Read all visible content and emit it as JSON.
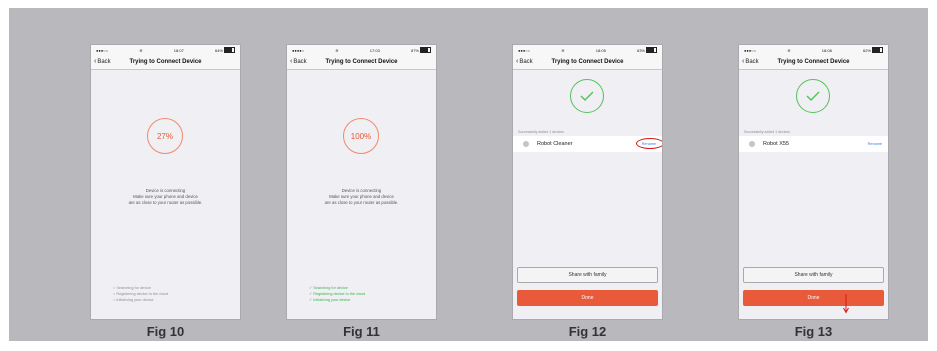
{
  "figures": [
    {
      "caption": "Fig 10",
      "status": {
        "carrier": "●●●○○",
        "wifi": "≋",
        "time": "18:07",
        "battery": "64%"
      },
      "nav": {
        "back": "Back",
        "title": "Trying to Connect Device"
      },
      "progress_text": "27%",
      "message": [
        "Device is connecting",
        "Make sure your phone and device",
        "are as close to your router as possible."
      ],
      "steps": [
        "Searching for device",
        "Registering device to the cloud",
        "Initializing your device"
      ]
    },
    {
      "caption": "Fig 11",
      "status": {
        "carrier": "●●●●○",
        "wifi": "≋",
        "time": "17:03",
        "battery": "87%"
      },
      "nav": {
        "back": "Back",
        "title": "Trying to Connect Device"
      },
      "progress_text": "100%",
      "message": [
        "Device is connecting",
        "Make sure your phone and device",
        "are as close to your router as possible."
      ],
      "steps": [
        "Searching for device",
        "Registering device to the cloud",
        "Initializing your device"
      ]
    },
    {
      "caption": "Fig 12",
      "status": {
        "carrier": "●●●○○",
        "wifi": "≋",
        "time": "18:05",
        "battery": "63%"
      },
      "nav": {
        "back": "Back",
        "title": "Trying to Connect Device"
      },
      "devices_label": "Successfully added 1 devices",
      "device_name": "Robot Cleaner",
      "rename_label": "Rename",
      "share_label": "Share with family",
      "done_label": "Done"
    },
    {
      "caption": "Fig 13",
      "status": {
        "carrier": "●●●○○",
        "wifi": "≋",
        "time": "18:08",
        "battery": "62%"
      },
      "nav": {
        "back": "Back",
        "title": "Trying to Connect Device"
      },
      "devices_label": "Successfully added 1 devices",
      "device_name": "Robot X55",
      "rename_label": "Rename",
      "share_label": "Share with family",
      "done_label": "Done"
    }
  ],
  "colors": {
    "accent": "#e85a3a",
    "success": "#39b54a",
    "link": "#3a7ce0",
    "annotation": "#d41b1b",
    "backdrop": "#b8b8bd"
  },
  "icons": [
    "back-chevron-icon",
    "wifi-icon",
    "battery-icon",
    "checkmark-icon",
    "device-icon",
    "pointer-arrow-icon"
  ]
}
